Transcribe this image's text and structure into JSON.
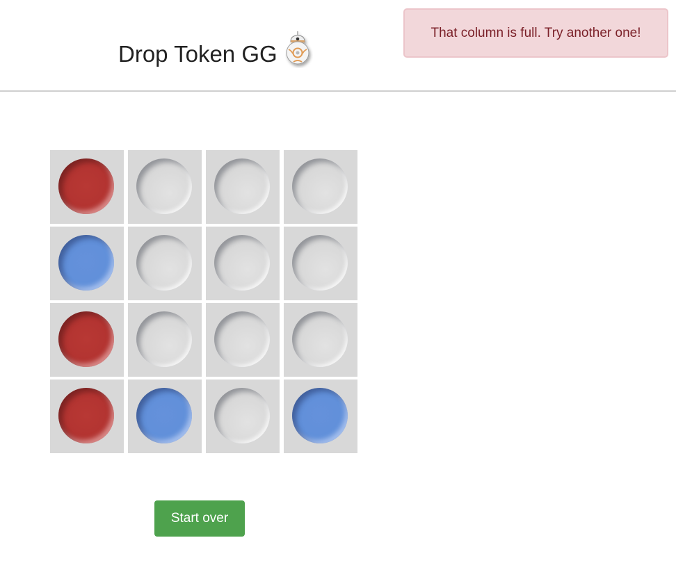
{
  "header": {
    "title": "Drop Token GG",
    "logo_icon": "bb8-droid-icon"
  },
  "alert": {
    "message": "That column is full. Try another one!"
  },
  "colors": {
    "red_token": "#b33431",
    "blue_token": "#6190da",
    "empty_cell": "#d8d8d8",
    "alert_bg": "#f2d7da",
    "alert_text": "#7a1f27",
    "button_bg": "#4ea24d"
  },
  "board": {
    "rows": [
      [
        "red",
        "empty",
        "empty",
        "empty"
      ],
      [
        "blue",
        "empty",
        "empty",
        "empty"
      ],
      [
        "red",
        "empty",
        "empty",
        "empty"
      ],
      [
        "red",
        "blue",
        "empty",
        "blue"
      ]
    ]
  },
  "controls": {
    "start_over_label": "Start over"
  }
}
